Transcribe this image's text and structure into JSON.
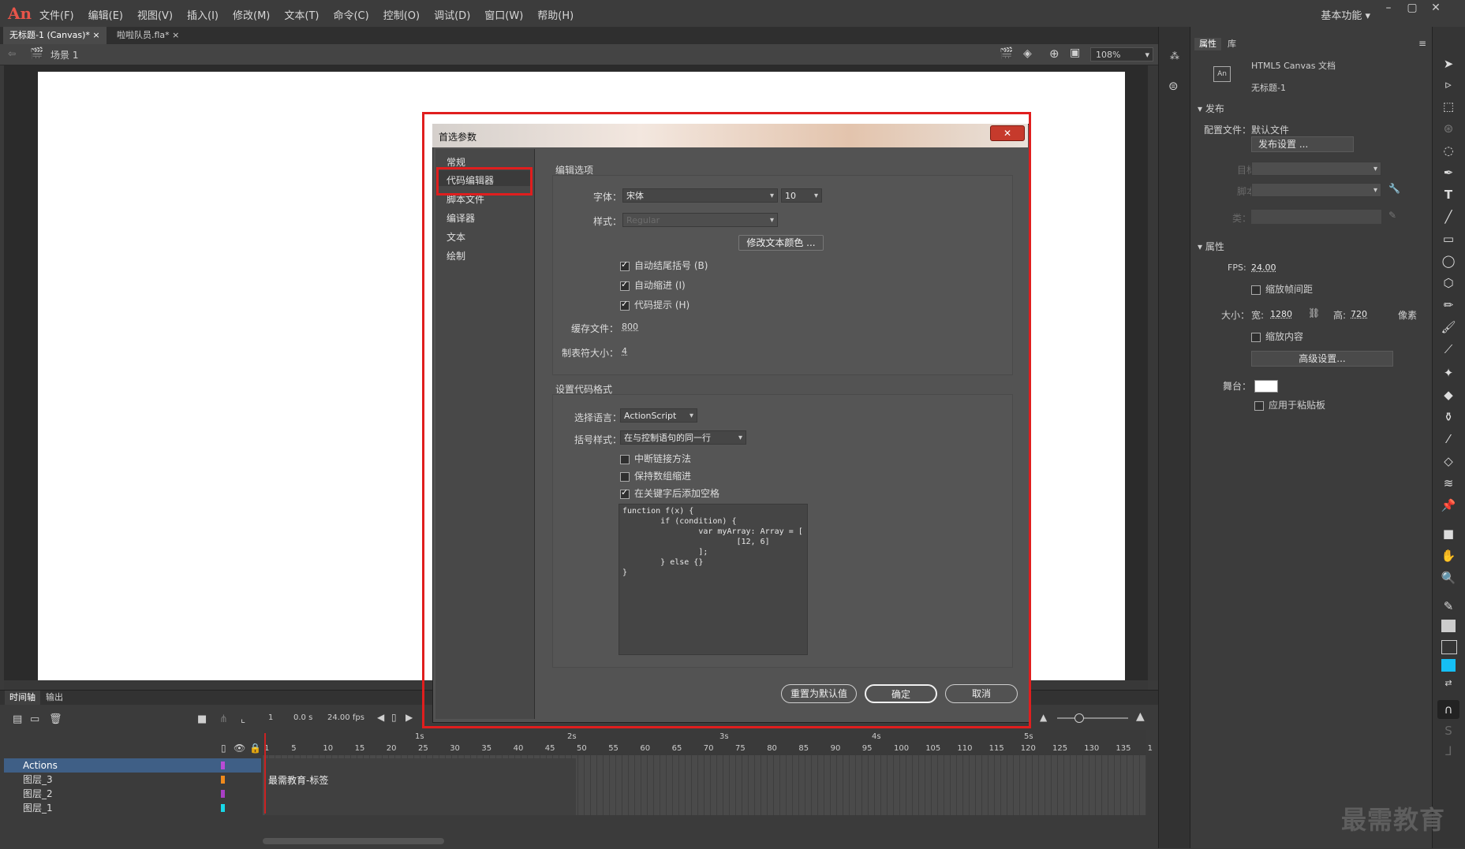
{
  "app": {
    "logo": "An"
  },
  "menu": [
    "文件(F)",
    "编辑(E)",
    "视图(V)",
    "插入(I)",
    "修改(M)",
    "文本(T)",
    "命令(C)",
    "控制(O)",
    "调试(D)",
    "窗口(W)",
    "帮助(H)"
  ],
  "workspace": "基本功能",
  "doc_tabs": [
    {
      "label": "无标题-1 (Canvas)*"
    },
    {
      "label": "啦啦队员.fla*"
    }
  ],
  "scene": {
    "label": "场景 1",
    "zoom": "108%"
  },
  "timeline": {
    "tabs": [
      "时间轴",
      "输出"
    ],
    "frame": "1",
    "time": "0.0 s",
    "fps": "24.00",
    "fps_unit": "fps",
    "sec_labels": [
      "1s",
      "2s",
      "3s",
      "4s",
      "5s"
    ],
    "frame_ticks": [
      "1",
      "5",
      "10",
      "15",
      "20",
      "25",
      "30",
      "35",
      "40",
      "45",
      "50",
      "55",
      "60",
      "65",
      "70",
      "75",
      "80",
      "85",
      "90",
      "95",
      "100",
      "105",
      "110",
      "115",
      "120",
      "125",
      "130",
      "135",
      "1"
    ],
    "layers": [
      {
        "name": "Actions",
        "color": "#b84bd6"
      },
      {
        "name": "图层_3",
        "color": "#f08a1c"
      },
      {
        "name": "图层_2",
        "color": "#a93fc4"
      },
      {
        "name": "图层_1",
        "color": "#18d8e8"
      }
    ],
    "frame_label": "最需教育-标签"
  },
  "properties": {
    "tabs": [
      "属性",
      "库"
    ],
    "doc_type": "HTML5 Canvas 文档",
    "doc_name": "无标题-1",
    "publish_section": "发布",
    "profile": "配置文件：默认文件",
    "publish_settings_btn": "发布设置 ...",
    "target_label": "目标：",
    "script_label": "脚本：",
    "class_label": "类：",
    "props_section": "属性",
    "fps_label": "FPS:",
    "fps_value": "24.00",
    "scale_spans": "缩放帧间距",
    "size_label": "大小：",
    "width_label": "宽:",
    "width": "1280",
    "height_label": "高:",
    "height": "720",
    "unit": "像素",
    "scale_content": "缩放内容",
    "advanced_btn": "高级设置...",
    "stage_label": "舞台：",
    "stage_color": "#ffffff",
    "apply_pasteboard": "应用于粘贴板"
  },
  "dialog": {
    "title": "首选参数",
    "close": "✕",
    "categories": [
      "常规",
      "代码编辑器",
      "脚本文件",
      "编译器",
      "文本",
      "绘制"
    ],
    "selected_category": "代码编辑器",
    "edit_options_title": "编辑选项",
    "font_label": "字体：",
    "font_value": "宋体",
    "font_size": "10",
    "style_label": "样式：",
    "style_value": "Regular",
    "modify_color_btn": "修改文本颜色 ...",
    "auto_close": "自动结尾括号 (B)",
    "auto_indent": "自动缩进 (I)",
    "code_hints": "代码提示 (H)",
    "cache_label": "缓存文件：",
    "cache_value": "800",
    "tab_size_label": "制表符大小：",
    "tab_size_value": "4",
    "format_title": "设置代码格式",
    "lang_label": "选择语言：",
    "lang_value": "ActionScript",
    "brace_label": "括号样式：",
    "brace_value": "在与控制语句的同一行",
    "break_chain": "中断链接方法",
    "keep_array_indent": "保持数组缩进",
    "space_after_keyword": "在关键字后添加空格",
    "code_preview": "function f(x) {\n        if (condition) {\n                var myArray: Array = [\n                        [12, 6]\n                ];\n        } else {}\n}",
    "reset_btn": "重置为默认值",
    "ok_btn": "确定",
    "cancel_btn": "取消"
  },
  "watermark": "最需教育"
}
